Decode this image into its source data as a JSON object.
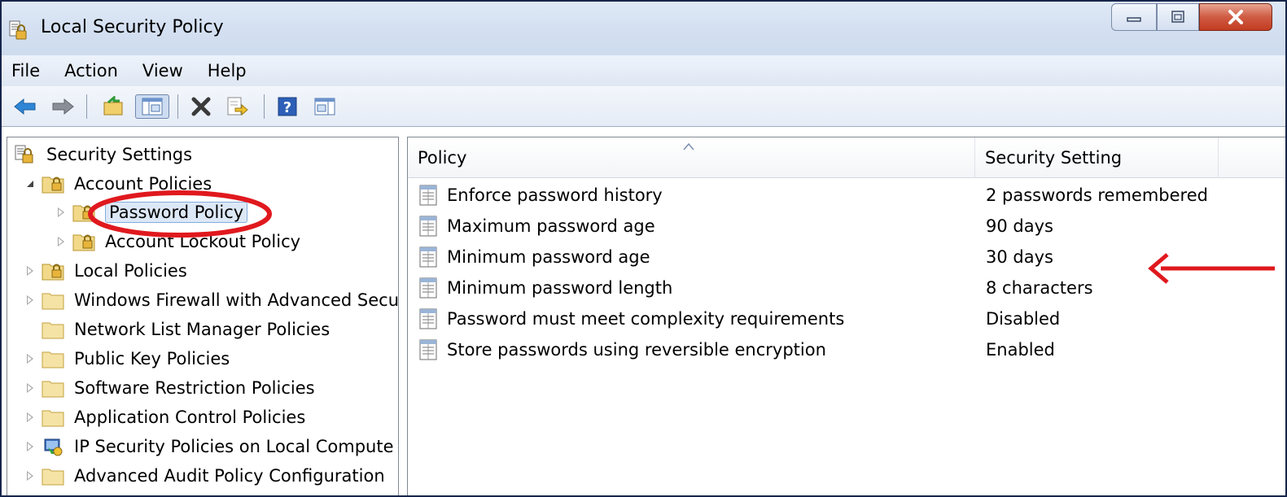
{
  "window": {
    "title": "Local Security Policy"
  },
  "menu": [
    "File",
    "Action",
    "View",
    "Help"
  ],
  "toolbar": {
    "icons": [
      "back-arrow-icon",
      "forward-arrow-icon",
      "up-folder-icon",
      "show-hide-tree-icon",
      "delete-icon",
      "export-list-icon",
      "help-icon",
      "show-action-pane-icon"
    ]
  },
  "tree": {
    "root": "Security Settings",
    "account_policies": "Account Policies",
    "password_policy": "Password Policy",
    "account_lockout_policy": "Account Lockout Policy",
    "local_policies": "Local Policies",
    "windows_firewall": "Windows Firewall with Advanced Secu",
    "network_list": "Network List Manager Policies",
    "public_key": "Public Key Policies",
    "software_restriction": "Software Restriction Policies",
    "application_control": "Application Control Policies",
    "ip_security": "IP Security Policies on Local Compute",
    "advanced_audit": "Advanced Audit Policy Configuration"
  },
  "list": {
    "columns": {
      "policy": "Policy",
      "setting": "Security Setting"
    },
    "rows": [
      {
        "policy": "Enforce password history",
        "setting": "2 passwords remembered"
      },
      {
        "policy": "Maximum password age",
        "setting": "90 days"
      },
      {
        "policy": "Minimum password age",
        "setting": "30 days"
      },
      {
        "policy": "Minimum password length",
        "setting": "8 characters"
      },
      {
        "policy": "Password must meet complexity requirements",
        "setting": "Disabled"
      },
      {
        "policy": "Store passwords using reversible encryption",
        "setting": "Enabled"
      }
    ]
  },
  "colors": {
    "annotation": "#e0191e",
    "selection": "#dde8f6",
    "titlebar": "#d5e1f2"
  }
}
